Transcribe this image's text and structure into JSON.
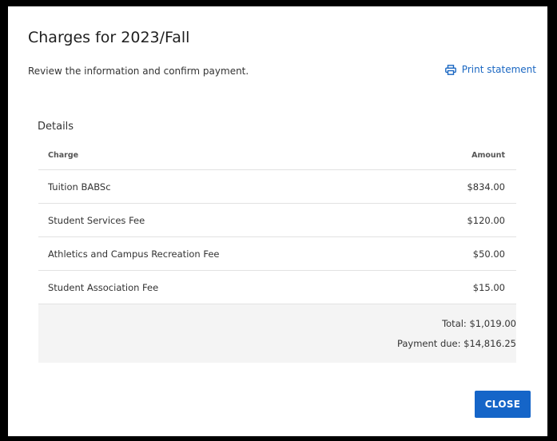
{
  "dialog": {
    "title": "Charges for 2023/Fall",
    "subtitle": "Review the information and confirm payment.",
    "print_label": "Print statement",
    "print_icon": "printer-icon",
    "accent_color": "#1565c8"
  },
  "details": {
    "heading": "Details",
    "columns": {
      "charge": "Charge",
      "amount": "Amount"
    },
    "rows": [
      {
        "charge": "Tuition BABSc",
        "amount": "$834.00"
      },
      {
        "charge": "Student Services Fee",
        "amount": "$120.00"
      },
      {
        "charge": "Athletics and Campus Recreation Fee",
        "amount": "$50.00"
      },
      {
        "charge": "Student Association Fee",
        "amount": "$15.00"
      }
    ],
    "total": "Total: $1,019.00",
    "payment_due": "Payment due: $14,816.25"
  },
  "actions": {
    "close_label": "CLOSE"
  }
}
